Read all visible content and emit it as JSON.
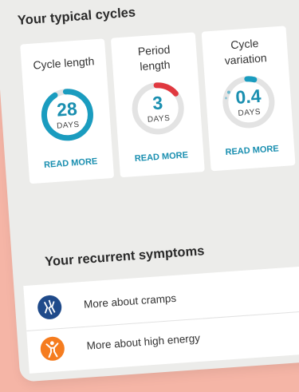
{
  "typical_cycles": {
    "title": "Your typical cycles",
    "cards": [
      {
        "label_lines": [
          "Cycle length"
        ],
        "value": "28",
        "unit": "DAYS",
        "link": "READ MORE",
        "progress": 0.92,
        "color": "#1a9cbf"
      },
      {
        "label_lines": [
          "Period",
          "length"
        ],
        "value": "3",
        "unit": "DAYS",
        "link": "READ MORE",
        "progress": 0.15,
        "color": "#e0383f"
      },
      {
        "label_lines": [
          "Cycle",
          "variation"
        ],
        "value": "0.4",
        "unit": "DAYS",
        "link": "READ MORE",
        "progress": 0.05,
        "color": "#1a9cbf"
      }
    ]
  },
  "recurrent_symptoms": {
    "title": "Your recurrent symptoms",
    "items": [
      {
        "label": "More about cramps",
        "icon": "cramps-icon",
        "icon_color": "#1f4a8a"
      },
      {
        "label": "More about high energy",
        "icon": "high-energy-icon",
        "icon_color": "#f57c1f"
      }
    ]
  },
  "colors": {
    "background": "#f5b5a6",
    "panel": "#ececea",
    "accent": "#1a8fb0"
  }
}
